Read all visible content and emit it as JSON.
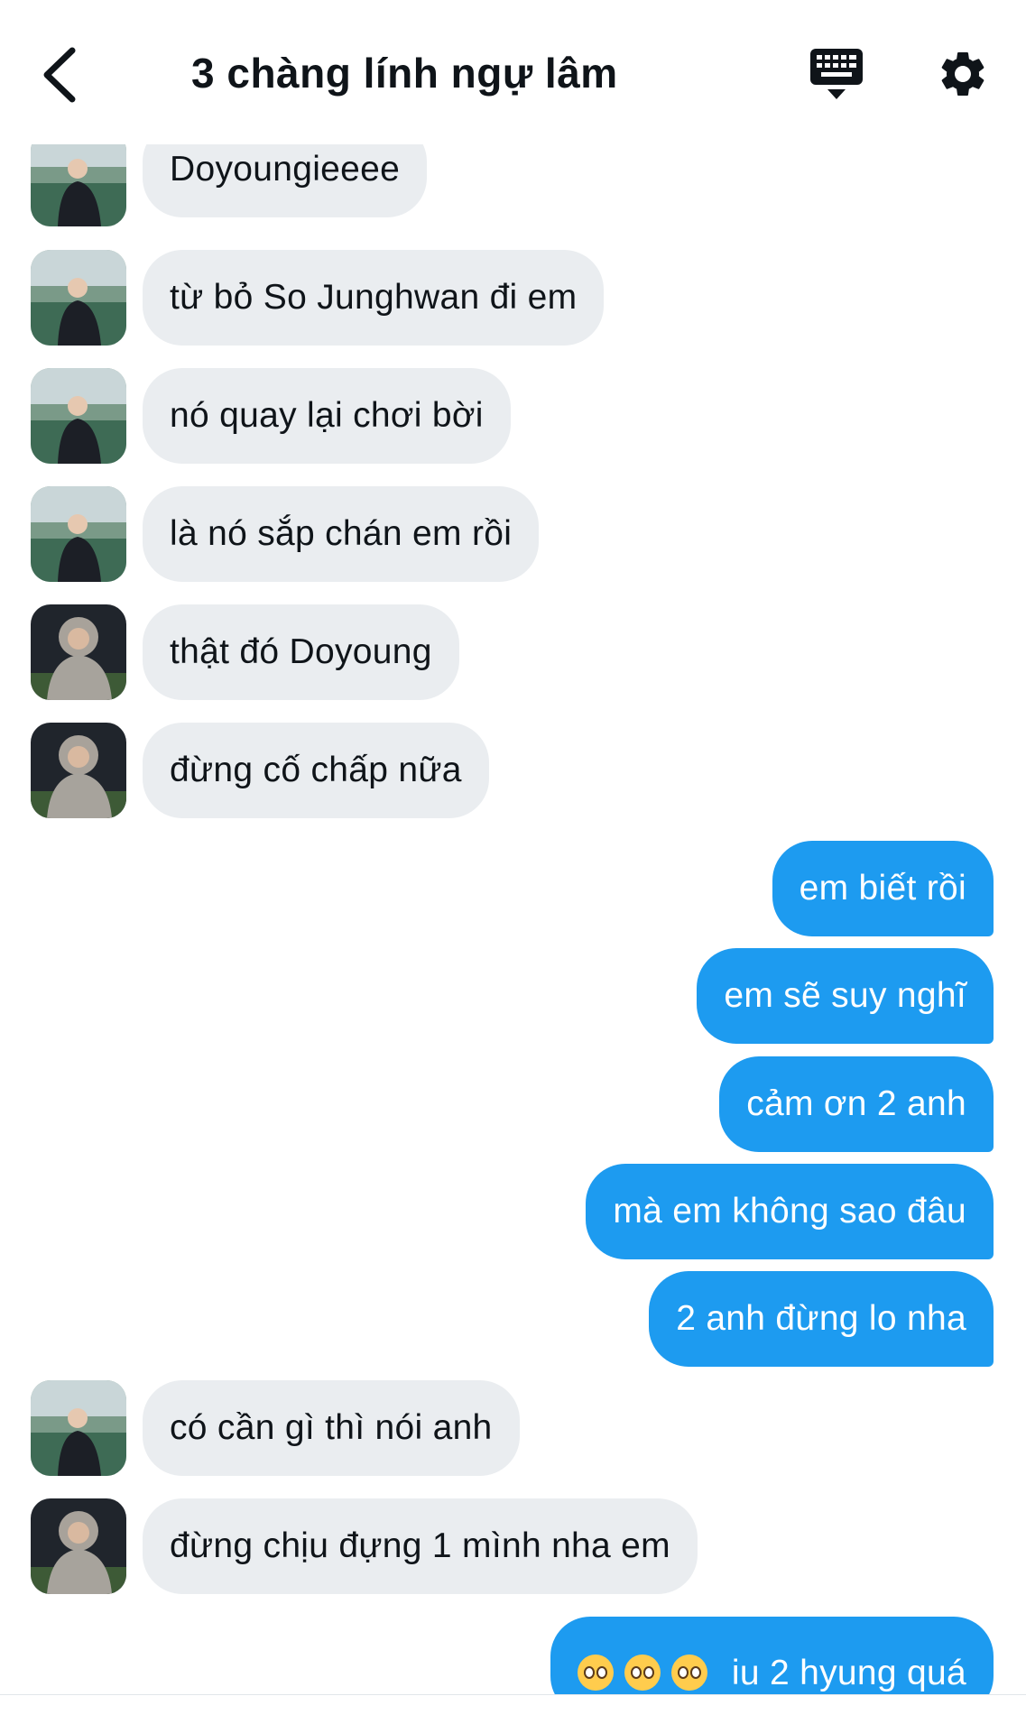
{
  "header": {
    "title": "3 chàng lính ngự lâm"
  },
  "icons": {
    "back": "chevron-left-icon",
    "keyboard": "keyboard-icon",
    "settings": "gear-icon"
  },
  "colors": {
    "outgoing": "#1d9bf0",
    "incoming": "#eaedf0"
  },
  "messages": [
    {
      "dir": "in",
      "sender": "a",
      "text": "Doyoungieeee"
    },
    {
      "dir": "in",
      "sender": "a",
      "text": "từ bỏ So Junghwan đi em"
    },
    {
      "dir": "in",
      "sender": "a",
      "text": "nó quay lại chơi bời"
    },
    {
      "dir": "in",
      "sender": "a",
      "text": "là nó sắp chán em rồi"
    },
    {
      "dir": "in",
      "sender": "b",
      "text": "thật đó Doyoung"
    },
    {
      "dir": "in",
      "sender": "b",
      "text": "đừng cố chấp nữa"
    },
    {
      "dir": "out",
      "text": "em biết rồi"
    },
    {
      "dir": "out",
      "text": "em sẽ suy nghĩ"
    },
    {
      "dir": "out",
      "text": "cảm ơn 2 anh"
    },
    {
      "dir": "out",
      "text": "mà em không sao đâu"
    },
    {
      "dir": "out",
      "text": "2 anh đừng lo nha"
    },
    {
      "dir": "in",
      "sender": "a",
      "text": "có cần gì thì nói anh"
    },
    {
      "dir": "in",
      "sender": "b",
      "text": "đừng chịu đựng 1 mình nha em"
    },
    {
      "dir": "out",
      "text": "iu 2 hyung quá",
      "emoji_count": 3
    }
  ]
}
